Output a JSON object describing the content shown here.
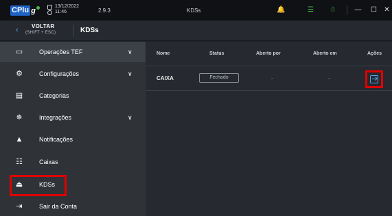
{
  "titlebar": {
    "logo_c": "CPlu",
    "logo_rest": "g",
    "date": "13/12/2022",
    "time": "11:46",
    "version": "2.9.3",
    "window_title": "KDSs"
  },
  "header": {
    "back_label": "VOLTAR",
    "back_shortcut": "(SHIFT + ESC)",
    "page_title": "KDSs"
  },
  "sidebar": {
    "items": [
      {
        "label": "Operações TEF",
        "icon": "credit-card-icon",
        "chevron": true
      },
      {
        "label": "Configurações",
        "icon": "gear-icon",
        "chevron": true
      },
      {
        "label": "Categorias",
        "icon": "list-icon",
        "chevron": false
      },
      {
        "label": "Integrações",
        "icon": "integration-icon",
        "chevron": true
      },
      {
        "label": "Notificações",
        "icon": "bell-icon",
        "chevron": false
      },
      {
        "label": "Caixas",
        "icon": "cash-register-icon",
        "chevron": false
      },
      {
        "label": "KDSs",
        "icon": "kds-icon",
        "chevron": false
      },
      {
        "label": "Sair da Conta",
        "icon": "logout-icon",
        "chevron": false
      }
    ]
  },
  "table": {
    "headers": [
      "Nome",
      "Status",
      "Aberto por",
      "Aberto em",
      "Ações"
    ],
    "rows": [
      {
        "nome": "CAIXA",
        "status": "Fechado",
        "aberto_por": "-",
        "aberto_em": "-"
      }
    ]
  },
  "colors": {
    "accent": "#5aa3e8",
    "highlight": "#e00000",
    "status_green": "#4db848"
  }
}
